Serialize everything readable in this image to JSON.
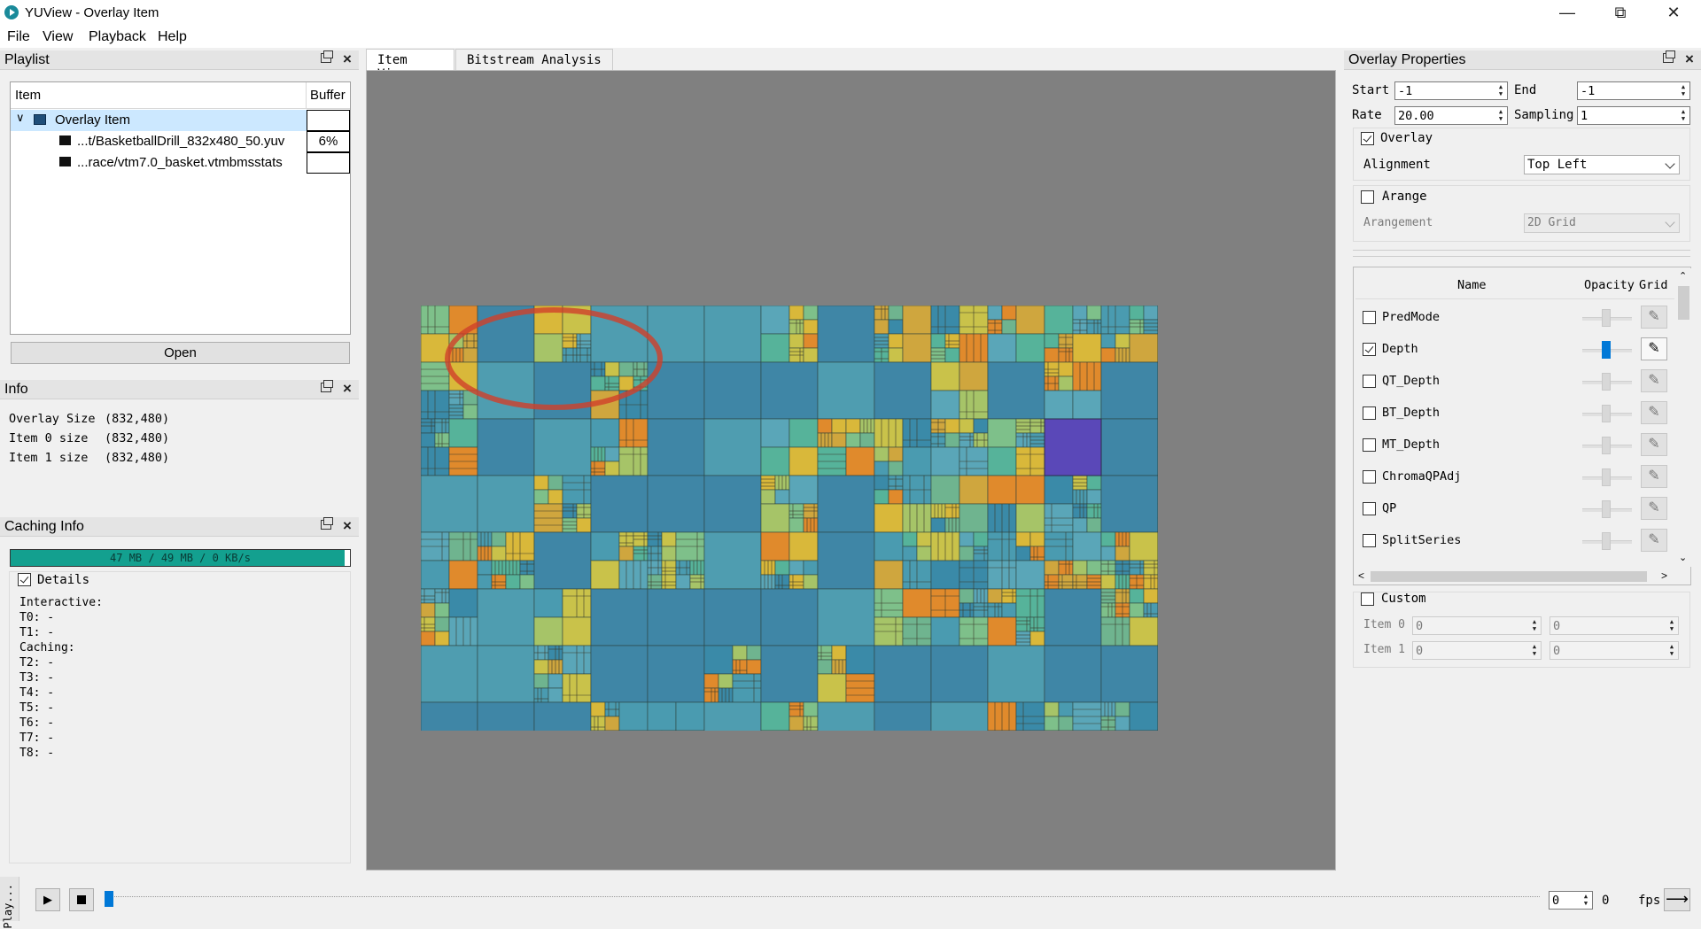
{
  "window": {
    "title": "YUView - Overlay Item",
    "min_icon": "minimize-icon",
    "max_icon": "restore-icon",
    "close_icon": "close-icon"
  },
  "menu": [
    "File",
    "View",
    "Playback",
    "Help"
  ],
  "playlist": {
    "title": "Playlist",
    "columns": [
      "Item",
      "Buffer"
    ],
    "items": [
      {
        "name": "Overlay Item",
        "buffer": "",
        "icon": "folder-icon"
      },
      {
        "name": "...t/BasketballDrill_832x480_50.yuv",
        "buffer": "6%",
        "icon": "video-file-icon"
      },
      {
        "name": "...race/vtm7.0_basket.vtmbmsstats",
        "buffer": "",
        "icon": "stats-file-icon"
      }
    ],
    "open_label": "Open"
  },
  "info": {
    "title": "Info",
    "lines": [
      {
        "label": "Overlay Size",
        "value": "(832,480)"
      },
      {
        "label": "Item 0 size",
        "value": "(832,480)"
      },
      {
        "label": "Item 1 size",
        "value": "(832,480)"
      }
    ]
  },
  "caching": {
    "title": "Caching Info",
    "bar_text": "47 MB / 49 MB / 0 KB/s",
    "bar_fraction": 0.985,
    "details_label": "Details",
    "details_checked": true,
    "lines": [
      "Interactive:",
      "T0: -",
      "T1: -",
      "Caching:",
      "T2: -",
      "T3: -",
      "T4: -",
      "T5: -",
      "T6: -",
      "T7: -",
      "T8: -"
    ]
  },
  "tabs": [
    "Item View",
    "Bitstream Analysis"
  ],
  "overlay": {
    "title": "Overlay Properties",
    "start_label": "Start",
    "start_value": "-1",
    "end_label": "End",
    "end_value": "-1",
    "rate_label": "Rate",
    "rate_value": "20.00",
    "sampling_label": "Sampling",
    "sampling_value": "1",
    "overlay_label": "Overlay",
    "overlay_checked": true,
    "alignment_label": "Alignment",
    "alignment_value": "Top Left",
    "arrange_label": "Arange",
    "arrange_checked": false,
    "arrangement_label": "Arangement",
    "arrangement_value": "2D Grid",
    "table_headers": [
      "Name",
      "Opacity",
      "Grid"
    ],
    "stats": [
      {
        "name": "PredMode",
        "checked": false
      },
      {
        "name": "Depth",
        "checked": true
      },
      {
        "name": "QT_Depth",
        "checked": false
      },
      {
        "name": "BT_Depth",
        "checked": false
      },
      {
        "name": "MT_Depth",
        "checked": false
      },
      {
        "name": "ChromaQPAdj",
        "checked": false
      },
      {
        "name": "QP",
        "checked": false
      },
      {
        "name": "SplitSeries",
        "checked": false
      }
    ],
    "custom_label": "Custom",
    "item0_label": "Item 0",
    "item0_x": "0",
    "item0_y": "0",
    "item1_label": "Item 1",
    "item1_x": "0",
    "item1_y": "0"
  },
  "playback": {
    "frame_value": "0",
    "frame_total": "0",
    "fps_label": "fps",
    "side_tab": "Play..."
  },
  "colors": {
    "accent": "#0078d7",
    "cache_bar": "#13a08f"
  }
}
